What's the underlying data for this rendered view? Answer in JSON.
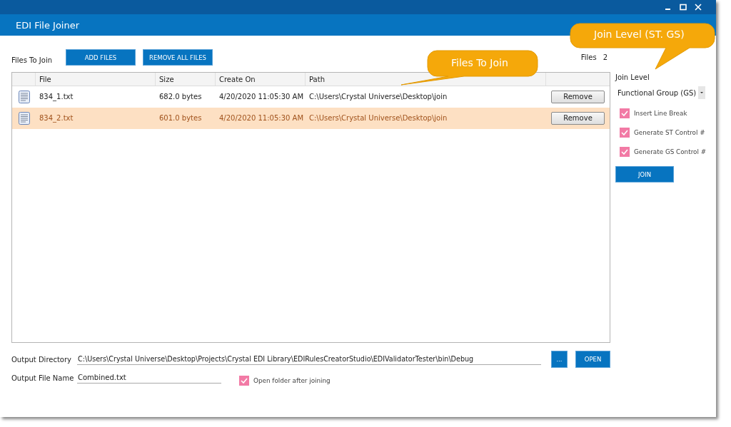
{
  "window": {
    "title": "EDI File Joiner"
  },
  "files_panel": {
    "label": "Files To Join",
    "add_button": "ADD FILES",
    "remove_all_button": "REMOVE ALL FILES",
    "count_label": "Files",
    "count": "2"
  },
  "table": {
    "columns": [
      {
        "label": "File"
      },
      {
        "label": "Size"
      },
      {
        "label": "Create On"
      },
      {
        "label": "Path"
      }
    ],
    "rows": [
      {
        "file": "834_1.txt",
        "size": "682.0 bytes",
        "created": "4/20/2020 11:05:30 AM",
        "path": "C:\\Users\\Crystal Universe\\Desktop\\join",
        "button": "Remove",
        "selected": false
      },
      {
        "file": "834_2.txt",
        "size": "601.0 bytes",
        "created": "4/20/2020 11:05:30 AM",
        "path": "C:\\Users\\Crystal Universe\\Desktop\\join",
        "button": "Remove",
        "selected": true
      }
    ]
  },
  "join_panel": {
    "label": "Join Level",
    "select_value": "Functional Group (GS)",
    "options": [
      {
        "label": "Insert Line Break",
        "checked": true
      },
      {
        "label": "Generate ST Control #",
        "checked": true
      },
      {
        "label": "Generate GS Control #",
        "checked": true
      }
    ],
    "join_button": "JOIN"
  },
  "output": {
    "directory_label": "Output Directory",
    "directory": "C:\\Users\\Crystal Universe\\Desktop\\Projects\\Crystal EDI Library\\EDIRulesCreatorStudio\\EDIValidatorTester\\bin\\Debug",
    "browse_button": "...",
    "open_button": "OPEN",
    "file_name_label": "Output File Name",
    "file_name": "Combined.txt",
    "open_folder": {
      "label": "Open folder after joining",
      "checked": true
    }
  },
  "callouts": [
    {
      "text": "Join Level (ST. GS)"
    },
    {
      "text": "Files To Join"
    }
  ]
}
